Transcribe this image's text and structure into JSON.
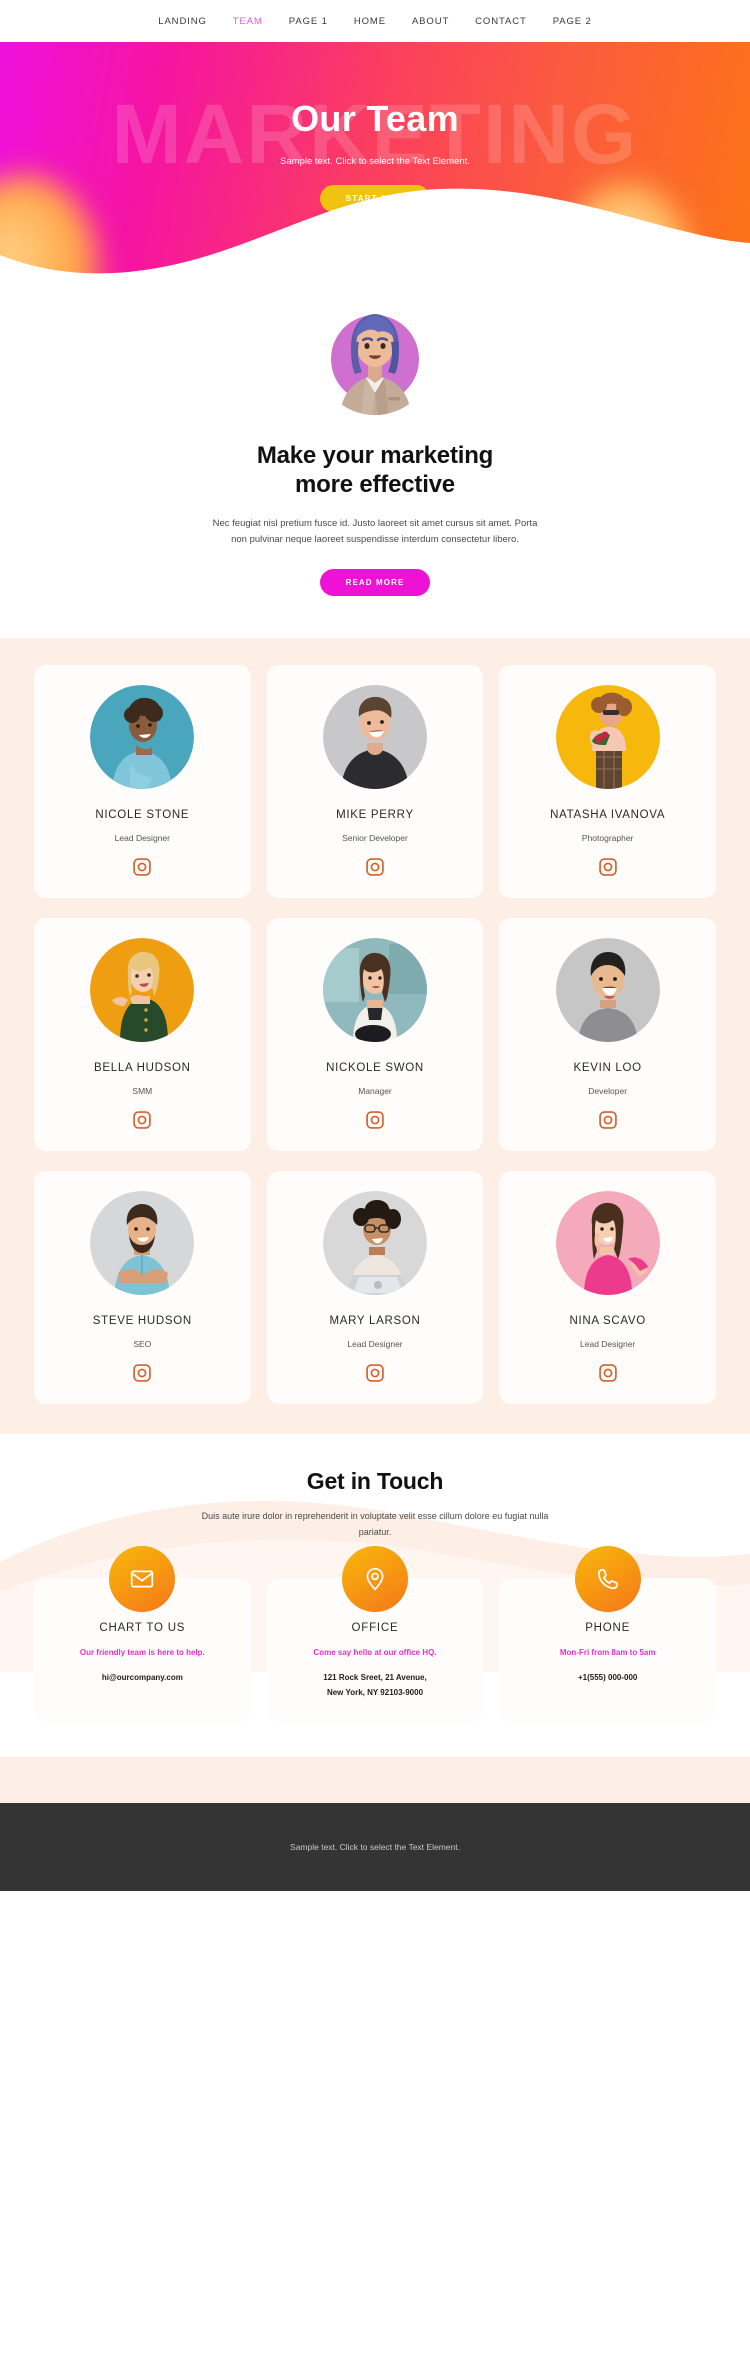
{
  "nav": {
    "items": [
      {
        "label": "LANDING",
        "active": false
      },
      {
        "label": "TEAM",
        "active": true
      },
      {
        "label": "PAGE 1",
        "active": false
      },
      {
        "label": "HOME",
        "active": false
      },
      {
        "label": "ABOUT",
        "active": false
      },
      {
        "label": "CONTACT",
        "active": false
      },
      {
        "label": "PAGE 2",
        "active": false
      }
    ]
  },
  "hero": {
    "watermark": "MARKETING",
    "title": "Our Team",
    "subtitle": "Sample text. Click to select the Text Element.",
    "button": "START NOW",
    "gradient_from": "#ef10dd",
    "gradient_to": "#fd7317",
    "button_color": "#f0c311"
  },
  "intro": {
    "heading_line1": "Make your marketing",
    "heading_line2": "more effective",
    "paragraph": "Nec feugiat nisl pretium fusce id. Justo laoreet sit amet cursus sit amet. Porta non pulvinar neque laoreet suspendisse interdum consectetur libero.",
    "button": "READ MORE",
    "button_color": "#ee12d6",
    "avatar_bg": "#cf6fd0"
  },
  "team": {
    "section_bg": "#fdeee6",
    "icon_name": "instagram-icon",
    "icon_color": "#d4602c",
    "members": [
      {
        "name": "NICOLE STONE",
        "role": "Lead Designer",
        "photo_bg": "#4aa6bd"
      },
      {
        "name": "MIKE PERRY",
        "role": "Senior Developer",
        "photo_bg": "#c8c8ca"
      },
      {
        "name": "NATASHA IVANOVA",
        "role": "Photographer",
        "photo_bg": "#f6b80d"
      },
      {
        "name": "BELLA HUDSON",
        "role": "SMM",
        "photo_bg": "#ef9d11"
      },
      {
        "name": "NICKOLE SWON",
        "role": "Manager",
        "photo_bg": "#8fb9bc"
      },
      {
        "name": "KEVIN LOO",
        "role": "Developer",
        "photo_bg": "#c6c6c6"
      },
      {
        "name": "STEVE HUDSON",
        "role": "SEO",
        "photo_bg": "#d5d7d8"
      },
      {
        "name": "MARY LARSON",
        "role": "Lead Designer",
        "photo_bg": "#d8d8d8"
      },
      {
        "name": "NINA SCAVO",
        "role": "Lead Designer",
        "photo_bg": "#f4aabb"
      }
    ]
  },
  "contact": {
    "heading": "Get in Touch",
    "paragraph": "Duis aute irure dolor in reprehenderit in voluptate velit esse cillum dolore eu fugiat nulla pariatur.",
    "accent_color": "#e231c8",
    "cards": [
      {
        "icon": "envelope-icon",
        "title": "CHART TO US",
        "subtitle": "Our friendly team is here to help.",
        "detail_line1": "hi@ourcompany.com",
        "detail_line2": ""
      },
      {
        "icon": "map-pin-icon",
        "title": "OFFICE",
        "subtitle": "Come say hello at our office HQ.",
        "detail_line1": "121 Rock Sreet, 21 Avenue,",
        "detail_line2": "New York, NY 92103-9000"
      },
      {
        "icon": "phone-icon",
        "title": "PHONE",
        "subtitle": "Mon-Fri from 8am to 5am",
        "detail_line1": "+1(555) 000-000",
        "detail_line2": ""
      }
    ]
  },
  "footer": {
    "text": "Sample text. Click to select the Text Element.",
    "bg": "#343434"
  }
}
